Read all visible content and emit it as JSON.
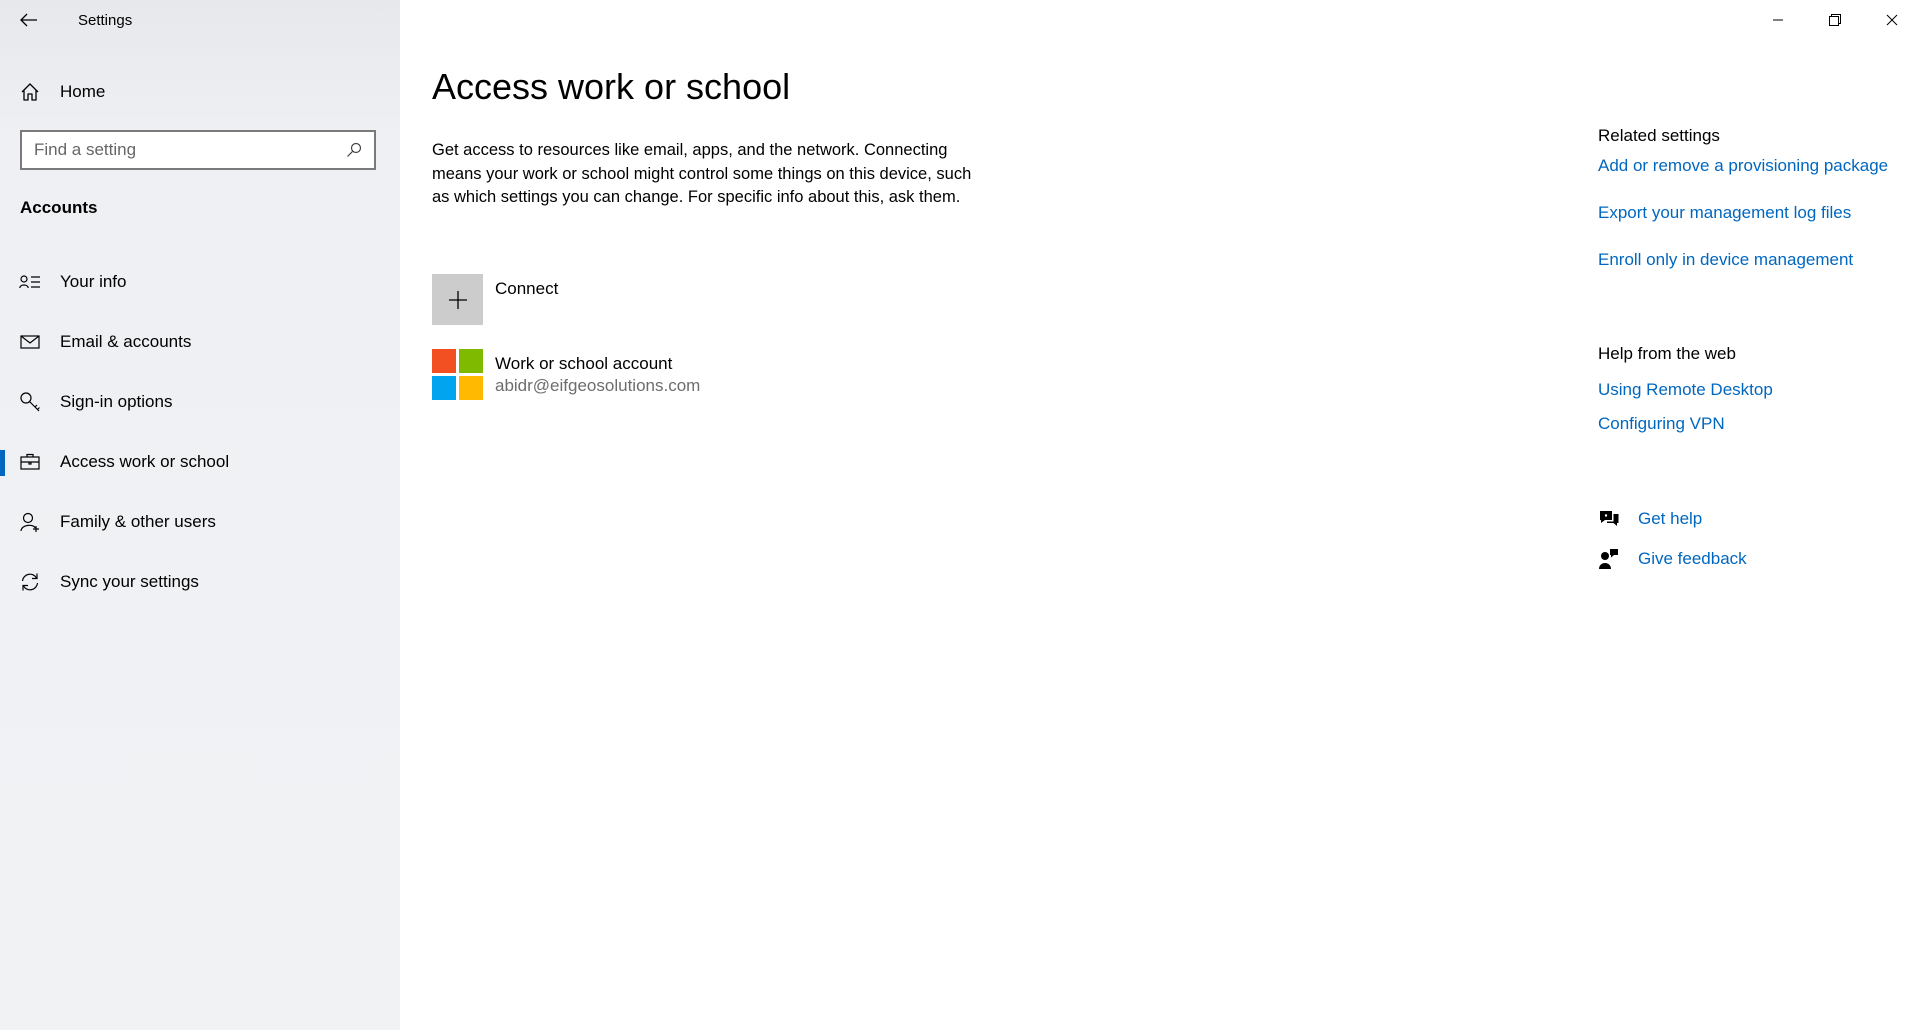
{
  "window": {
    "title": "Settings"
  },
  "sidebar": {
    "home_label": "Home",
    "search_placeholder": "Find a setting",
    "section": "Accounts",
    "items": [
      {
        "label": "Your info",
        "icon": "contact-card-icon"
      },
      {
        "label": "Email & accounts",
        "icon": "mail-icon"
      },
      {
        "label": "Sign-in options",
        "icon": "key-icon"
      },
      {
        "label": "Access work or school",
        "icon": "briefcase-icon",
        "selected": true
      },
      {
        "label": "Family & other users",
        "icon": "person-add-icon"
      },
      {
        "label": "Sync your settings",
        "icon": "sync-icon"
      }
    ]
  },
  "main": {
    "title": "Access work or school",
    "description": "Get access to resources like email, apps, and the network. Connecting means your work or school might control some things on this device, such as which settings you can change. For specific info about this, ask them.",
    "connect_label": "Connect",
    "account": {
      "name": "Work or school account",
      "email": "abidr@eifgeosolutions.com"
    }
  },
  "related": {
    "heading": "Related settings",
    "links": [
      "Add or remove a provisioning package",
      "Export your management log files",
      "Enroll only in device management"
    ]
  },
  "help_web": {
    "heading": "Help from the web",
    "links": [
      "Using Remote Desktop",
      "Configuring VPN"
    ]
  },
  "support": {
    "get_help": "Get help",
    "give_feedback": "Give feedback"
  },
  "colors": {
    "accent": "#0067c0",
    "ms_red": "#f25022",
    "ms_green": "#7fba00",
    "ms_blue": "#00a4ef",
    "ms_yellow": "#ffb900"
  }
}
